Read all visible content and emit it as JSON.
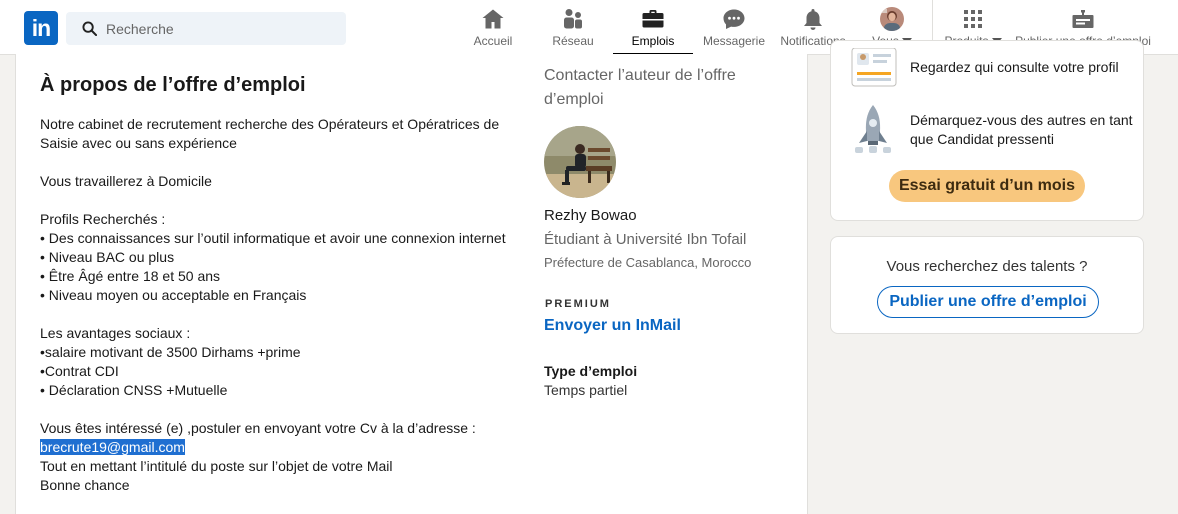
{
  "nav": {
    "search_placeholder": "Recherche",
    "items": [
      {
        "label": "Accueil",
        "icon": "home-icon"
      },
      {
        "label": "Réseau",
        "icon": "network-icon"
      },
      {
        "label": "Emplois",
        "icon": "briefcase-icon",
        "active": true
      },
      {
        "label": "Messagerie",
        "icon": "messaging-icon"
      },
      {
        "label": "Notifications",
        "icon": "bell-icon"
      },
      {
        "label": "Vous",
        "icon": "profile-avatar"
      },
      {
        "label": "Produits",
        "icon": "grid-icon"
      },
      {
        "label": "Publier une offre d’emploi",
        "icon": "post-job-icon"
      }
    ]
  },
  "job": {
    "about_title": "À propos de l’offre d’emploi",
    "description": [
      "Notre cabinet de recrutement recherche des Opérateurs et Opératrices de",
      "Saisie avec ou sans expérience",
      "",
      "Vous travaillerez à Domicile",
      "",
      "Profils Recherchés :",
      "• Des connaissances sur l’outil informatique et avoir une connexion internet",
      "• Niveau BAC ou plus",
      "• Être Âgé entre 18 et 50 ans",
      "• Niveau moyen ou acceptable en Français",
      "",
      "Les avantages sociaux :",
      "•salaire motivant de 3500 Dirhams +prime",
      "•Contrat CDI",
      "• Déclaration CNSS +Mutuelle",
      "",
      "Vous êtes intéressé (e) ,postuler en envoyant votre Cv à la d’adresse :",
      "brecrute19@gmail.com",
      "Tout en mettant l’intitulé du poste sur l’objet de votre Mail",
      "Bonne chance"
    ],
    "contact_title": "Contacter l’auteur de l’offre d’emploi",
    "poster_name": "Rezhy Bowao",
    "poster_headline": "Étudiant à Université Ibn Tofail",
    "poster_location": "Préfecture de Casablanca, Morocco",
    "premium_label": "PREMIUM",
    "inmail_label": "Envoyer un InMail",
    "employment_type_label": "Type d’emploi",
    "employment_type_value": "Temps partiel"
  },
  "premium_card": {
    "feature_1": "Regardez qui consulte votre profil",
    "feature_2": "Démarquez-vous des autres en tant que Candidat pressenti",
    "trial_button": "Essai gratuit d’un mois"
  },
  "talent_card": {
    "question": "Vous recherchez des talents ?",
    "post_button": "Publier une offre d’emploi"
  },
  "colors": {
    "brand": "#0a66c2",
    "trial_button": "#f8c77e",
    "highlight": "#1f6fd1"
  }
}
